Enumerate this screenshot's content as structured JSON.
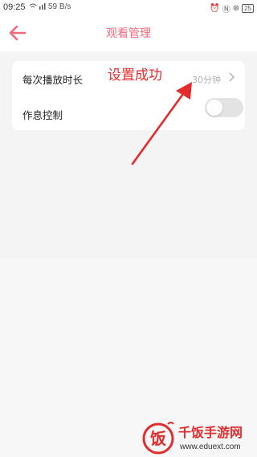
{
  "status_bar": {
    "time": "09:25",
    "speed": "59 B/s",
    "battery": "25",
    "icons_left": [
      "wifi-icon",
      "signal-icon",
      "signal-icon"
    ],
    "icons_right": [
      "alarm-icon",
      "nfc-icon",
      "data-icon"
    ]
  },
  "header": {
    "title": "观看管理",
    "back_icon": "arrow-left-icon",
    "accent_color": "#f06a7c"
  },
  "settings": {
    "playback_duration": {
      "label": "每次播放时长",
      "value": "30分钟"
    },
    "rest_control": {
      "label": "作息控制",
      "enabled": false
    }
  },
  "annotation": {
    "text": "设置成功",
    "color": "#e32b2b"
  },
  "watermark": {
    "name": "千饭手游网",
    "url": "www.eduext.com",
    "logo_char": "饭"
  }
}
